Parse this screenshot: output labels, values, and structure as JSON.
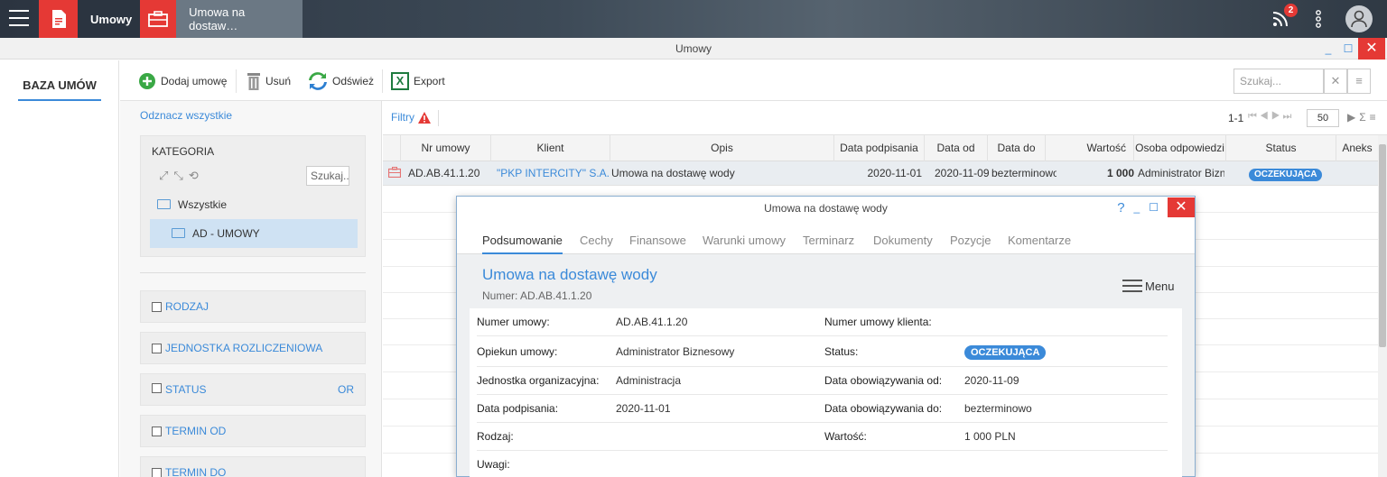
{
  "taskbar": {
    "tabs": [
      {
        "label": "Umowy"
      },
      {
        "label": "Umowa na dostaw…"
      }
    ],
    "notification_count": "2"
  },
  "window": {
    "title": "Umowy",
    "minimize": "_",
    "maximize": "☐",
    "close": "✕"
  },
  "leftnav": {
    "items": [
      {
        "label": "BAZA UMÓW"
      }
    ]
  },
  "toolbar": {
    "add_label": "Dodaj umowę",
    "delete_label": "Usuń",
    "refresh_label": "Odśwież",
    "export_label": "Export",
    "search_placeholder": "Szukaj...",
    "export_icon_text": "X"
  },
  "filters": {
    "select_all": "Odznacz wszystkie",
    "category": {
      "title": "KATEGORIA",
      "search_placeholder": "Szukaj...",
      "items": [
        {
          "label": "Wszystkie"
        },
        {
          "label": "AD - UMOWY"
        }
      ]
    },
    "groups": [
      {
        "label": "RODZAJ",
        "extra": ""
      },
      {
        "label": "JEDNOSTKA ROZLICZENIOWA",
        "extra": ""
      },
      {
        "label": "STATUS",
        "extra": "OR"
      },
      {
        "label": "TERMIN OD",
        "extra": ""
      },
      {
        "label": "TERMIN DO",
        "extra": ""
      }
    ]
  },
  "grid": {
    "filter_label": "Filtry",
    "pager": {
      "range": "1-1",
      "page_size": "50"
    },
    "columns": [
      "Nr umowy",
      "Klient",
      "Opis",
      "Data podpisania",
      "Data od",
      "Data do",
      "Wartość",
      "Osoba odpowiedzi",
      "Status",
      "Aneks"
    ],
    "rows": [
      {
        "nr": "AD.AB.41.1.20",
        "client": "\"PKP INTERCITY\" S.A.",
        "opis": "Umowa na dostawę wody",
        "data_podpisania": "2020-11-01",
        "data_od": "2020-11-09",
        "data_do": "bezterminowo",
        "wartosc": "1 000",
        "osoba": "Administrator Biznesowy",
        "status": "OCZEKUJĄCA",
        "aneks": ""
      }
    ]
  },
  "modal": {
    "title": "Umowa na dostawę wody",
    "help": "?",
    "tabs": [
      {
        "label": "Podsumowanie"
      },
      {
        "label": "Cechy"
      },
      {
        "label": "Finansowe"
      },
      {
        "label": "Warunki umowy"
      },
      {
        "label": "Terminarz"
      },
      {
        "label": "Dokumenty"
      },
      {
        "label": "Pozycje"
      },
      {
        "label": "Komentarze"
      }
    ],
    "heading": "Umowa na dostawę wody",
    "number": "Numer: AD.AB.41.1.20",
    "menu_label": "Menu",
    "details": [
      {
        "l1": "Numer umowy:",
        "v1": "AD.AB.41.1.20",
        "l2": "Numer umowy klienta:",
        "v2": ""
      },
      {
        "l1": "Opiekun umowy:",
        "v1": "Administrator Biznesowy",
        "l2": "Status:",
        "v2": "OCZEKUJĄCA"
      },
      {
        "l1": "Jednostka organizacyjna:",
        "v1": "Administracja",
        "l2": "Data obowiązywania od:",
        "v2": "2020-11-09"
      },
      {
        "l1": "Data podpisania:",
        "v1": "2020-11-01",
        "l2": "Data obowiązywania do:",
        "v2": "bezterminowo"
      },
      {
        "l1": "Rodzaj:",
        "v1": "",
        "l2": "Wartość:",
        "v2": "1 000 PLN"
      },
      {
        "l1": "Uwagi:",
        "v1": "",
        "l2": "",
        "v2": ""
      }
    ]
  },
  "colors": {
    "accent": "#3b8ad9",
    "danger": "#e53935"
  }
}
